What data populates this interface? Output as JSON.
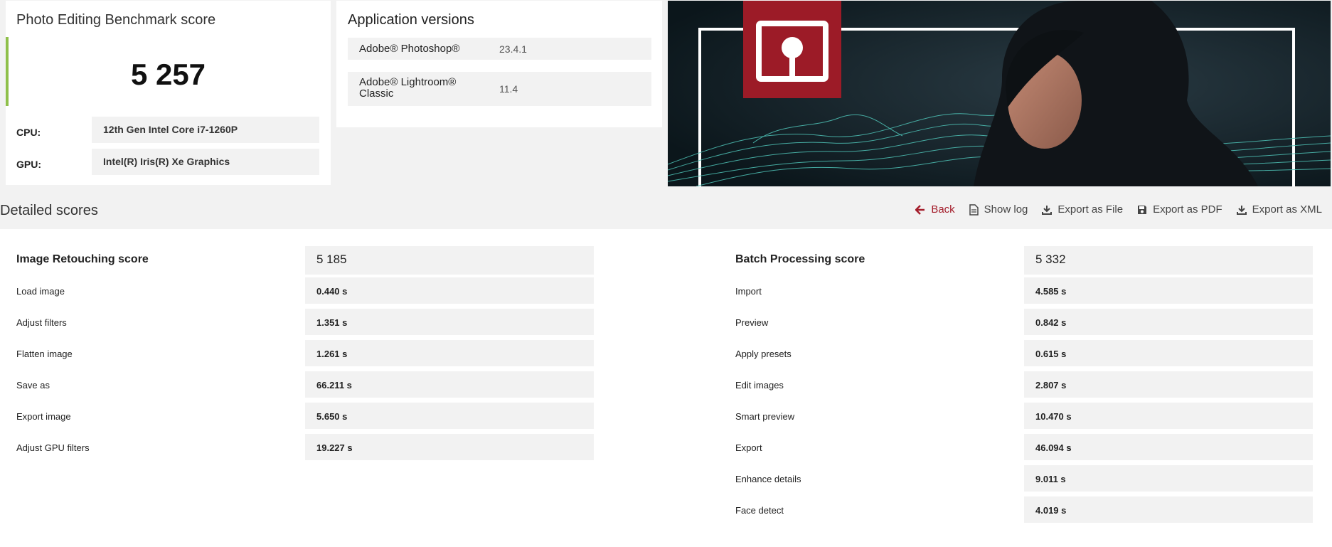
{
  "score_card": {
    "title": "Photo Editing Benchmark score",
    "score": "5 257",
    "cpu_label": "CPU:",
    "cpu_value": "12th Gen Intel Core i7-1260P",
    "gpu_label": "GPU:",
    "gpu_value": "Intel(R) Iris(R) Xe Graphics",
    "accent_color": "#8fc04a"
  },
  "versions": {
    "title": "Application versions",
    "rows": [
      {
        "name": "Adobe® Photoshop®",
        "value": "23.4.1"
      },
      {
        "name_line1": "Adobe® Lightroom®",
        "name_line2": "Classic",
        "value": "11.4"
      }
    ]
  },
  "hero": {
    "logo_color": "#9c1b27",
    "wave_color": "#4fc4b8",
    "icon": "benchmark-logo-icon"
  },
  "detailed": {
    "title": "Detailed scores",
    "actions": [
      {
        "label": "Back",
        "icon": "back-arrow-icon",
        "color": "#a41d2b"
      },
      {
        "label": "Show log",
        "icon": "document-icon"
      },
      {
        "label": "Export as File",
        "icon": "download-icon"
      },
      {
        "label": "Export as PDF",
        "icon": "save-icon"
      },
      {
        "label": "Export as XML",
        "icon": "download-icon"
      }
    ],
    "image_retouching": {
      "title": "Image Retouching score",
      "score": "5 185",
      "items": [
        {
          "label": "Load image",
          "value": "0.440 s"
        },
        {
          "label": "Adjust filters",
          "value": "1.351 s"
        },
        {
          "label": "Flatten image",
          "value": "1.261 s"
        },
        {
          "label": "Save as",
          "value": "66.211 s"
        },
        {
          "label": "Export image",
          "value": "5.650 s"
        },
        {
          "label": "Adjust GPU filters",
          "value": "19.227 s"
        }
      ]
    },
    "batch_processing": {
      "title": "Batch Processing score",
      "score": "5 332",
      "items": [
        {
          "label": "Import",
          "value": "4.585 s"
        },
        {
          "label": "Preview",
          "value": "0.842 s"
        },
        {
          "label": "Apply presets",
          "value": "0.615 s"
        },
        {
          "label": "Edit images",
          "value": "2.807 s"
        },
        {
          "label": "Smart preview",
          "value": "10.470 s"
        },
        {
          "label": "Export",
          "value": "46.094 s"
        },
        {
          "label": "Enhance details",
          "value": "9.011 s"
        },
        {
          "label": "Face detect",
          "value": "4.019 s"
        }
      ]
    }
  }
}
